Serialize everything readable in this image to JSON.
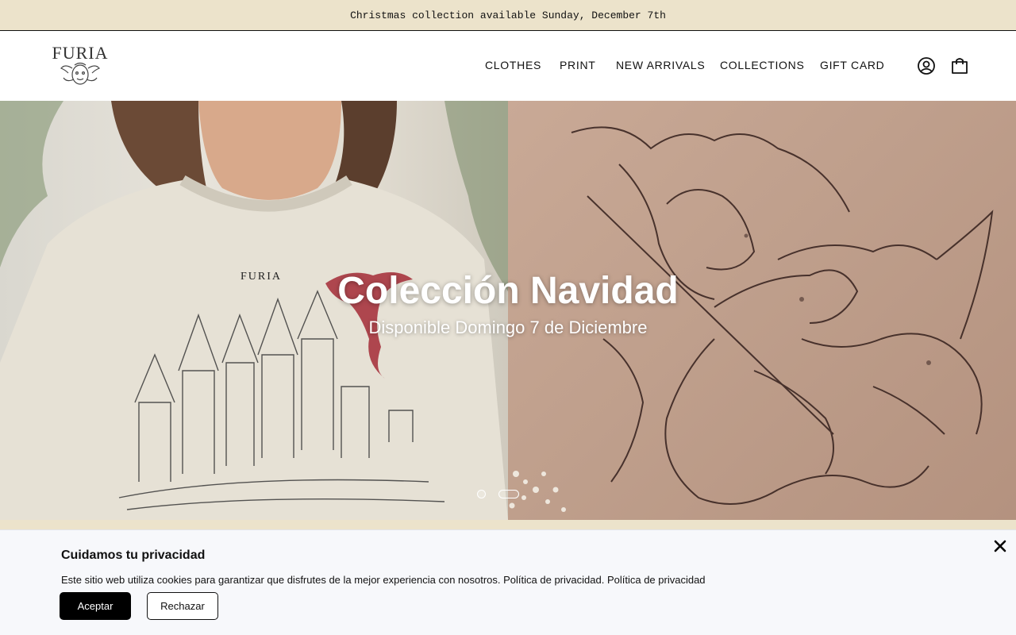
{
  "announcement": {
    "text": "Christmas collection available Sunday, December 7th"
  },
  "header": {
    "logo_text": "FURIA",
    "nav": [
      {
        "label": "CLOTHES"
      },
      {
        "label": "PRINT"
      },
      {
        "label": "NEW ARRIVALS"
      },
      {
        "label": "COLLECTIONS"
      },
      {
        "label": "GIFT CARD"
      }
    ],
    "icons": {
      "account": "account-icon",
      "cart": "shopping-bag-icon"
    }
  },
  "hero": {
    "title": "Colección Navidad",
    "subtitle": "Disponible Domingo 7 de Diciembre",
    "slides_total": 2,
    "active_slide": 2,
    "left_image_text": "FURIA"
  },
  "cookie_banner": {
    "title": "Cuidamos tu privacidad",
    "text": "Este sitio web utiliza cookies para garantizar que disfrutes de la mejor experiencia con nosotros.",
    "link1": "Política de privacidad.",
    "link2": "Política de privacidad",
    "accept_label": "Aceptar",
    "reject_label": "Rechazar"
  },
  "colors": {
    "announcement_bg": "#ece3cb",
    "accept_button": "#000000",
    "banner_bg": "#f7f8fb"
  }
}
